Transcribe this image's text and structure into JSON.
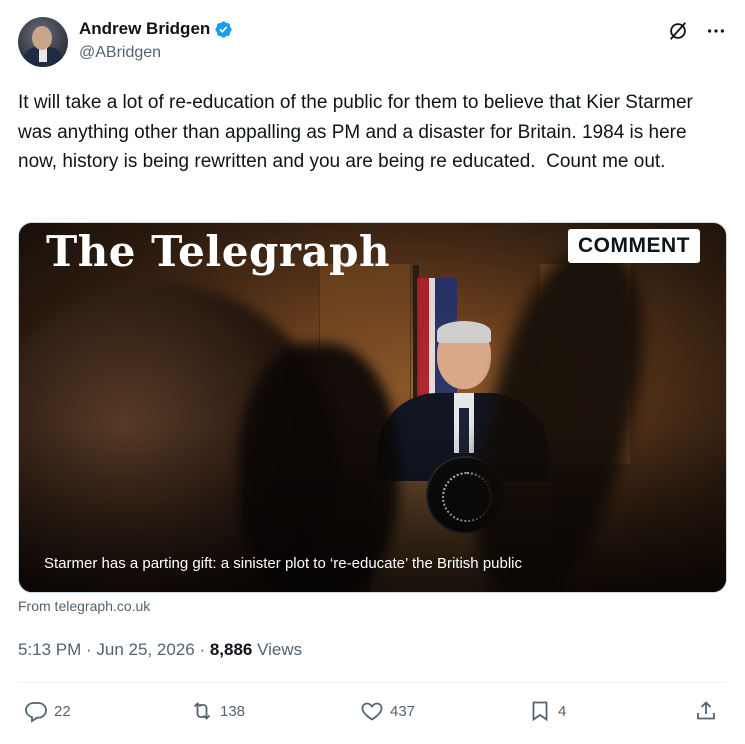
{
  "author": {
    "name": "Andrew Bridgen",
    "handle": "@ABridgen"
  },
  "tweet": {
    "text": "It will take a lot of re-education of the public for them to believe that Kier Starmer was anything other than appalling as PM and a disaster for Britain. 1984 is here now, history is being rewritten and you are being re educated.  Count me out."
  },
  "card": {
    "brand": "The Telegraph",
    "badge": "COMMENT",
    "caption": "Starmer has a parting gift: a sinister plot to ‘re-educate’ the British public",
    "source": "From telegraph.co.uk"
  },
  "meta": {
    "time": "5:13 PM",
    "separator1": " · ",
    "date": "Jun 25, 2026",
    "separator2": " · ",
    "views_count": "8,886",
    "views_label": " Views"
  },
  "actions": {
    "replies": "22",
    "reposts": "138",
    "likes": "437",
    "bookmarks": "4"
  },
  "icons": [
    "verified-badge-icon",
    "grok-icon",
    "more-icon",
    "reply-icon",
    "repost-icon",
    "like-icon",
    "bookmark-icon",
    "share-icon"
  ],
  "colors": {
    "verified": "#1d9bf0",
    "secondary_text": "#536471",
    "primary_text": "#0f1419"
  }
}
